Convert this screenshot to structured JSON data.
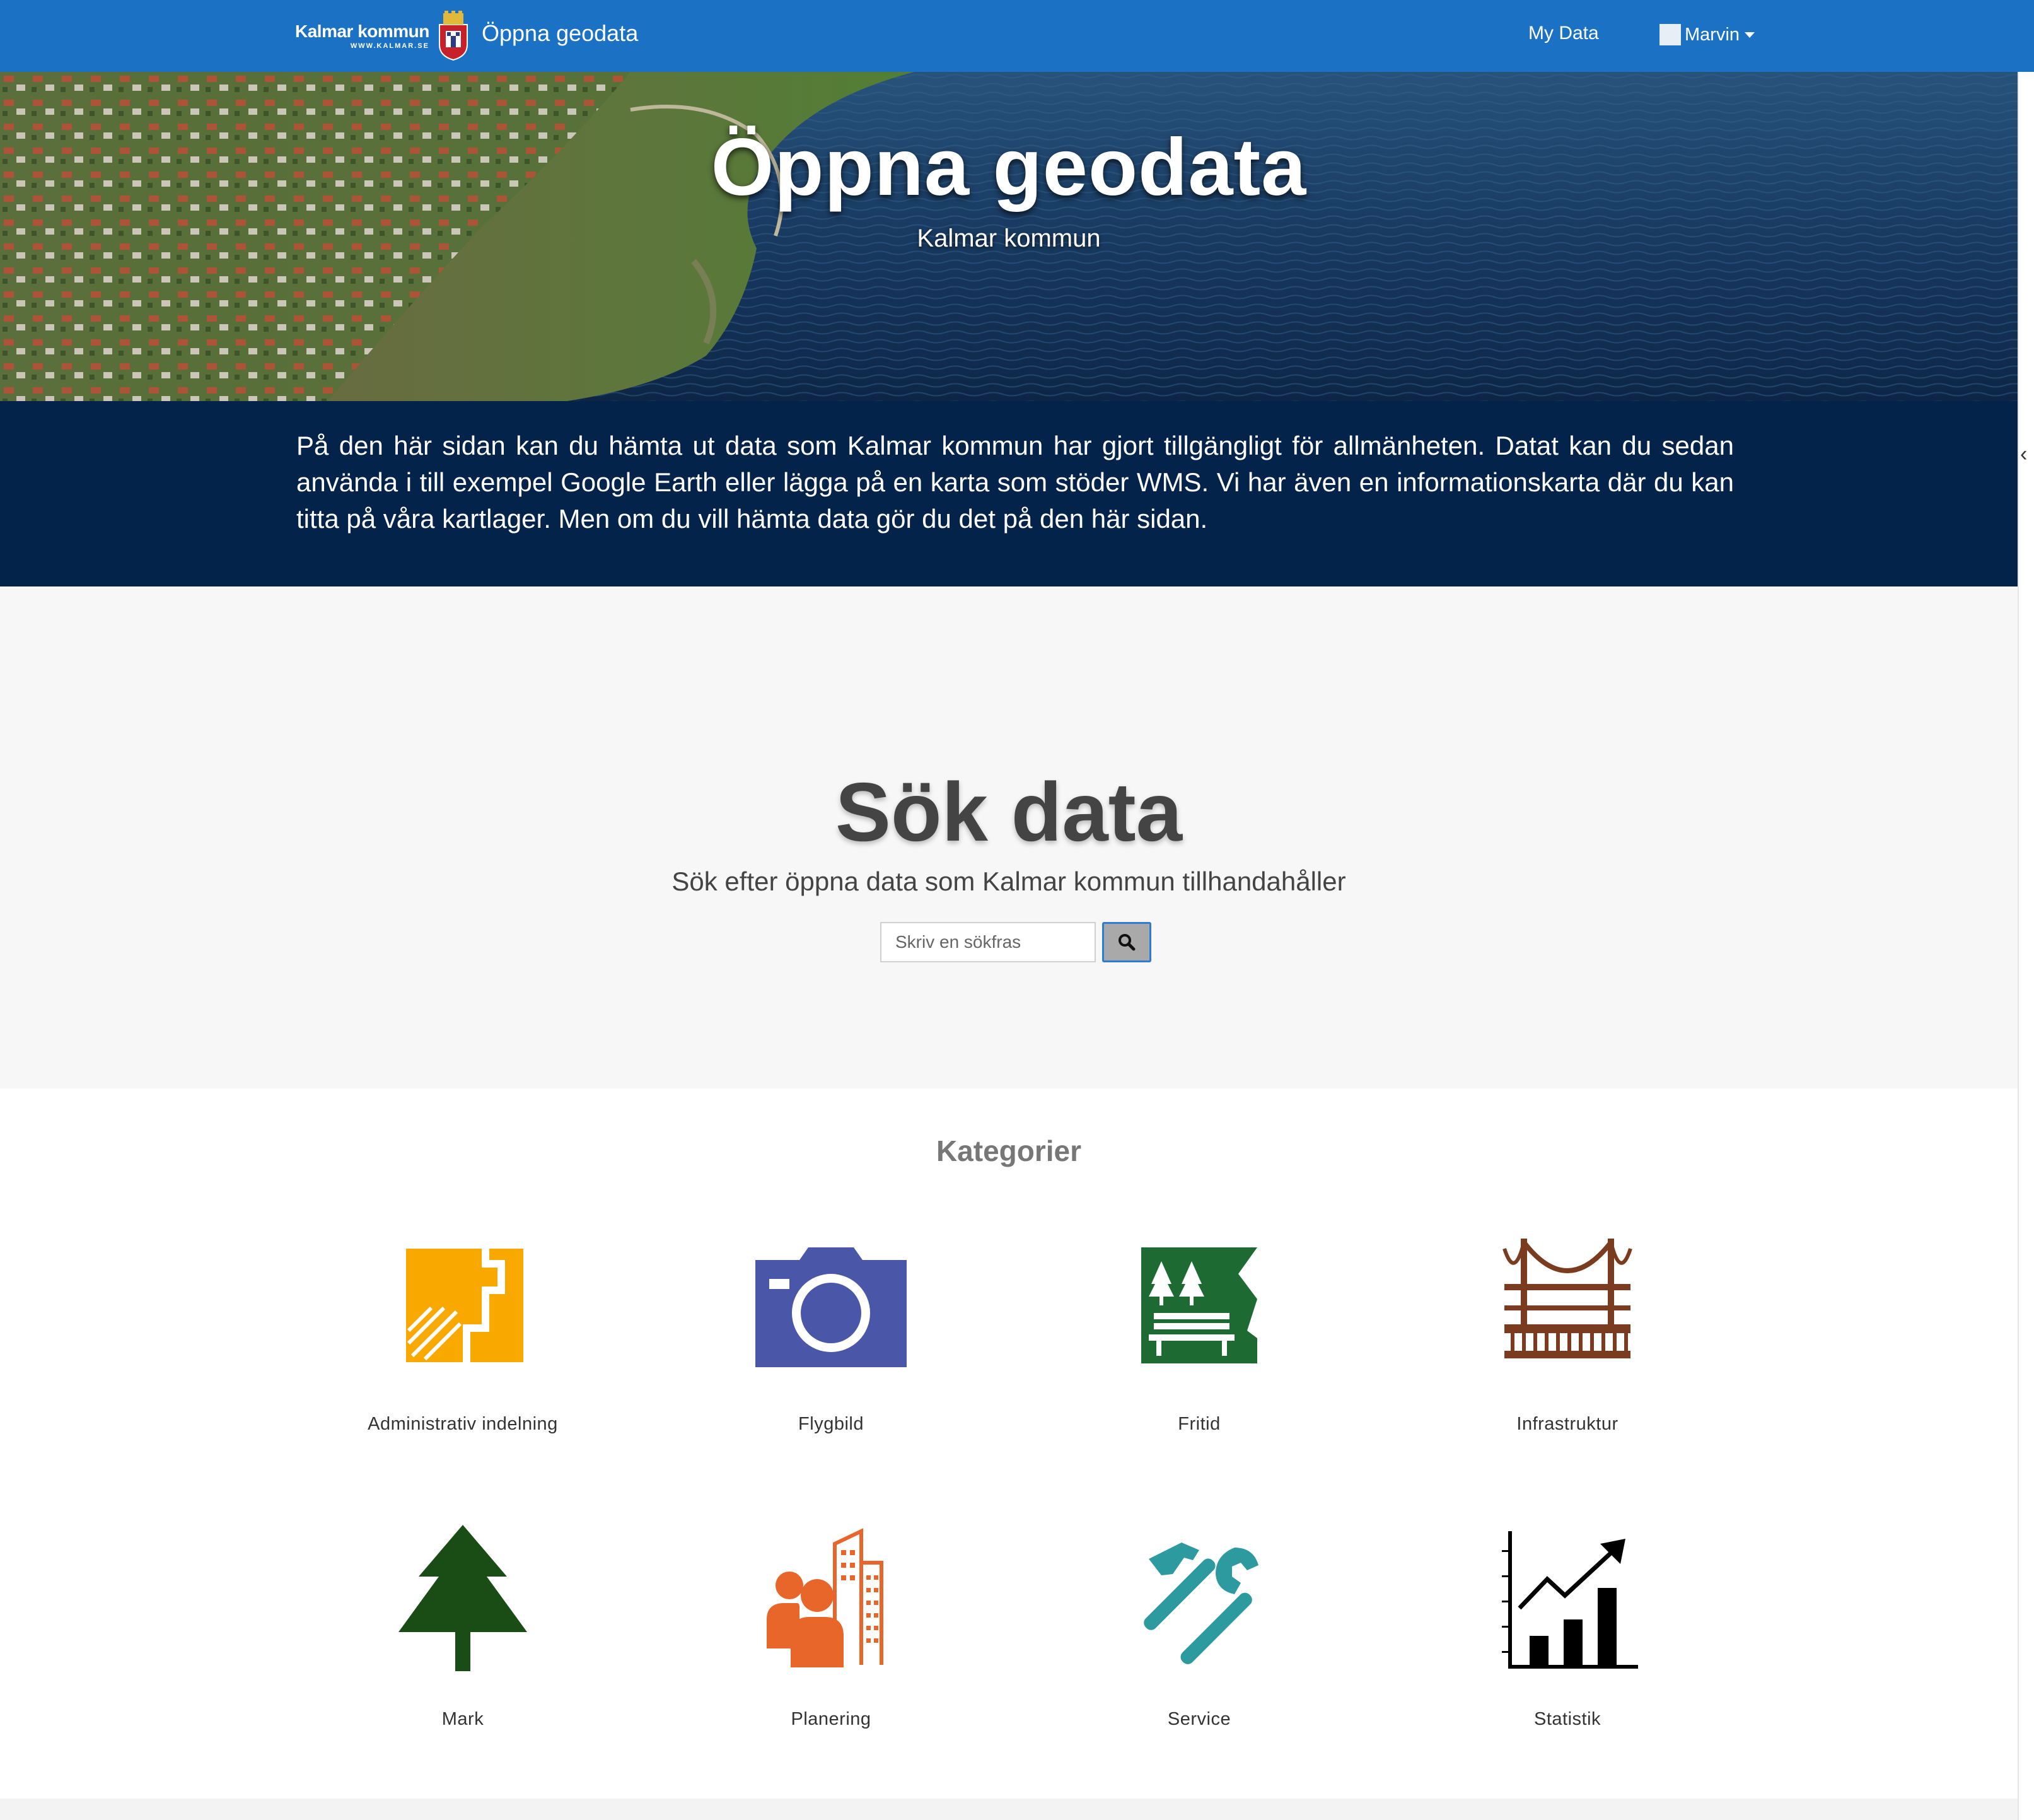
{
  "navbar": {
    "brand_name": "Kalmar kommun",
    "brand_url": "WWW.KALMAR.SE",
    "app_title": "Öppna geodata",
    "my_data": "My Data",
    "user_name": "Marvin"
  },
  "hero": {
    "title": "Öppna geodata",
    "subtitle": "Kalmar kommun"
  },
  "intro": {
    "text": "På den här sidan kan du hämta ut data som Kalmar kommun har gjort tillgängligt för allmänheten. Datat kan du sedan använda i till exempel Google Earth eller lägga på en karta som stöder WMS. Vi har även en informationskarta där du kan titta på våra kartlager. Men om du vill hämta data gör du det på den här sidan."
  },
  "search": {
    "title": "Sök data",
    "subtitle": "Sök efter öppna data som Kalmar kommun tillhandahåller",
    "placeholder": "Skriv en sökfras",
    "button_icon": "search-icon"
  },
  "categories": {
    "title": "Kategorier",
    "items": [
      {
        "label": "Administrativ indelning",
        "icon": "map-parcels-icon",
        "color": "#f9a800"
      },
      {
        "label": "Flygbild",
        "icon": "camera-icon",
        "color": "#4a57a8"
      },
      {
        "label": "Fritid",
        "icon": "park-bench-icon",
        "color": "#1d6b32"
      },
      {
        "label": "Infrastruktur",
        "icon": "bridge-icon",
        "color": "#7a3b1e"
      },
      {
        "label": "Mark",
        "icon": "tree-icon",
        "color": "#1a4d16"
      },
      {
        "label": "Planering",
        "icon": "people-buildings-icon",
        "color": "#e8662a"
      },
      {
        "label": "Service",
        "icon": "hammer-wrench-icon",
        "color": "#2d9aa0"
      },
      {
        "label": "Statistik",
        "icon": "chart-growth-icon",
        "color": "#000000"
      }
    ]
  },
  "colors": {
    "navbar": "#1b72c4",
    "intro_band": "#03234a",
    "search_bg": "#f7f7f7"
  }
}
